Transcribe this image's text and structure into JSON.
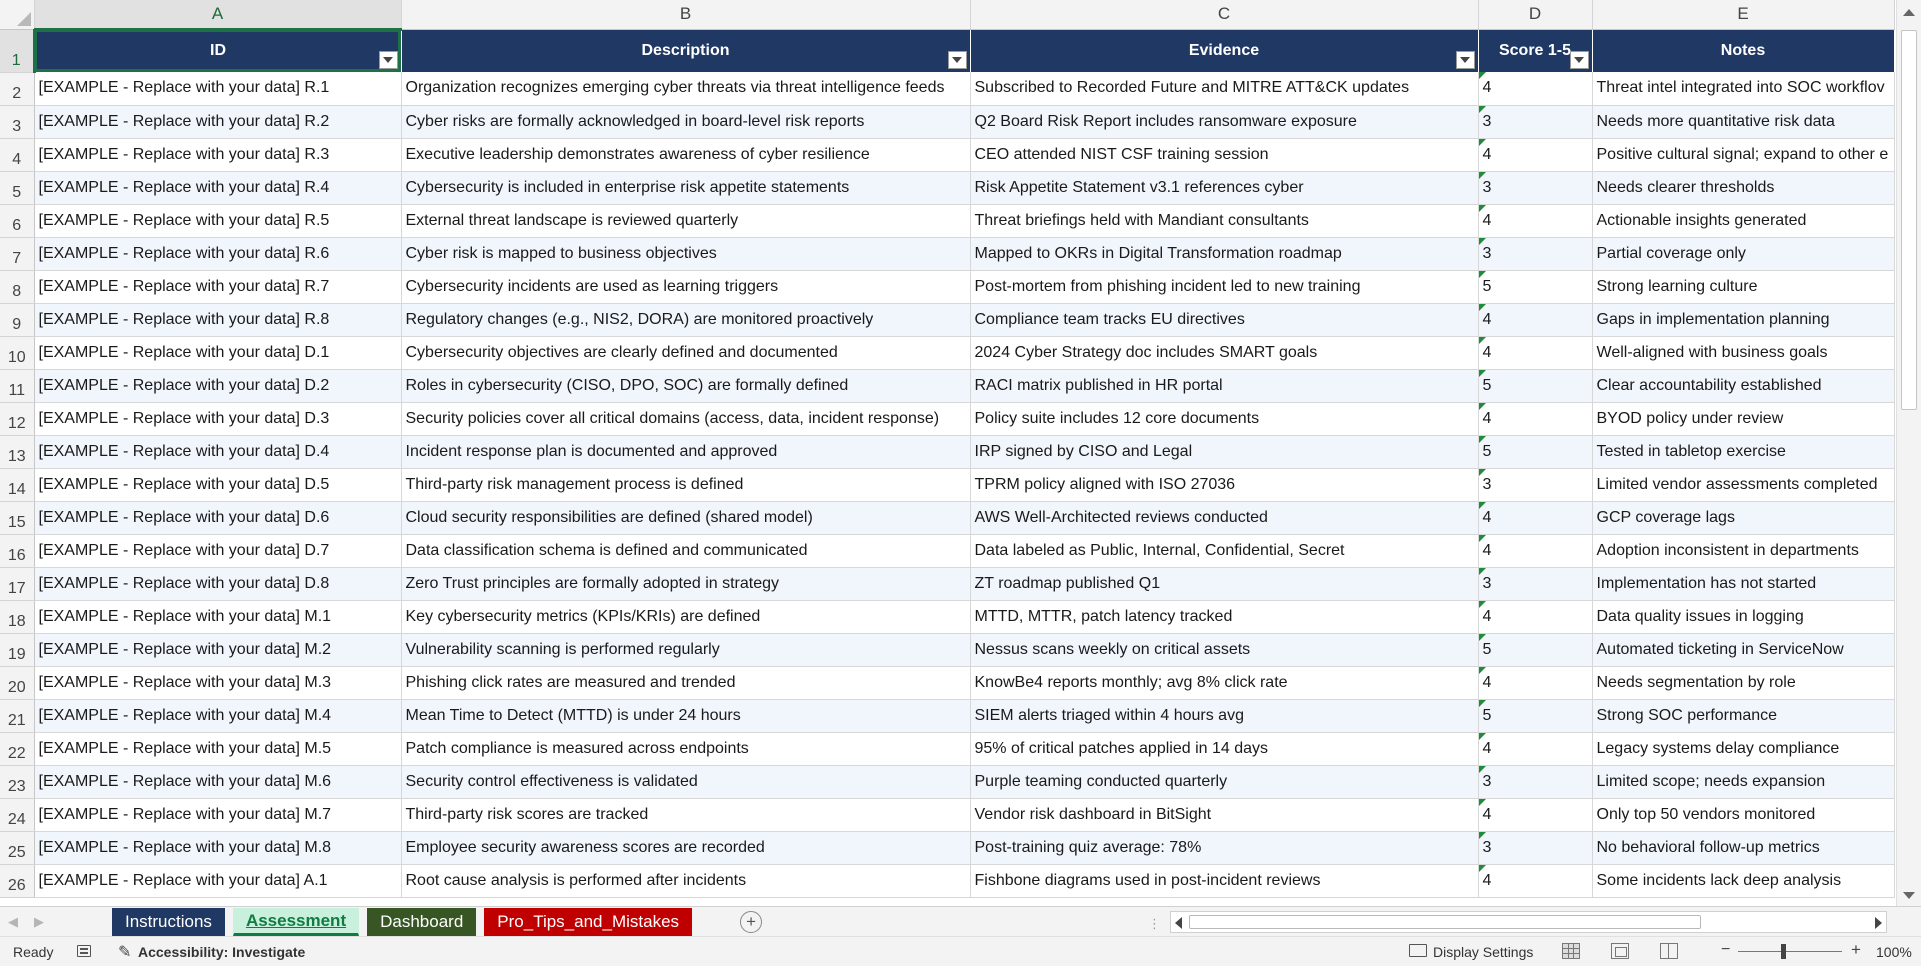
{
  "columns": {
    "a": "A",
    "b": "B",
    "c": "C",
    "d": "D",
    "e": "E"
  },
  "header": {
    "row_number": "1",
    "id": "ID",
    "description": "Description",
    "evidence": "Evidence",
    "score": "Score 1-5",
    "notes": "Notes"
  },
  "rows": [
    {
      "n": "2",
      "id": "[EXAMPLE - Replace with your data] R.1",
      "desc": "Organization recognizes emerging cyber threats via threat intelligence feeds",
      "evidence": "Subscribed to Recorded Future and MITRE ATT&CK updates",
      "score": "4",
      "notes": "Threat intel integrated into SOC workflov"
    },
    {
      "n": "3",
      "id": "[EXAMPLE - Replace with your data] R.2",
      "desc": "Cyber risks are formally acknowledged in board-level risk reports",
      "evidence": "Q2 Board Risk Report includes ransomware exposure",
      "score": "3",
      "notes": "Needs more quantitative risk data"
    },
    {
      "n": "4",
      "id": "[EXAMPLE - Replace with your data] R.3",
      "desc": "Executive leadership demonstrates awareness of cyber resilience",
      "evidence": "CEO attended NIST CSF training session",
      "score": "4",
      "notes": "Positive cultural signal; expand to other e"
    },
    {
      "n": "5",
      "id": "[EXAMPLE - Replace with your data] R.4",
      "desc": "Cybersecurity is included in enterprise risk appetite statements",
      "evidence": "Risk Appetite Statement v3.1 references cyber",
      "score": "3",
      "notes": "Needs clearer thresholds"
    },
    {
      "n": "6",
      "id": "[EXAMPLE - Replace with your data] R.5",
      "desc": "External threat landscape is reviewed quarterly",
      "evidence": "Threat briefings held with Mandiant consultants",
      "score": "4",
      "notes": "Actionable insights generated"
    },
    {
      "n": "7",
      "id": "[EXAMPLE - Replace with your data] R.6",
      "desc": "Cyber risk is mapped to business objectives",
      "evidence": "Mapped to OKRs in Digital Transformation roadmap",
      "score": "3",
      "notes": "Partial coverage only"
    },
    {
      "n": "8",
      "id": "[EXAMPLE - Replace with your data] R.7",
      "desc": "Cybersecurity incidents are used as learning triggers",
      "evidence": "Post-mortem from phishing incident led to new training",
      "score": "5",
      "notes": "Strong learning culture"
    },
    {
      "n": "9",
      "id": "[EXAMPLE - Replace with your data] R.8",
      "desc": "Regulatory changes (e.g., NIS2, DORA) are monitored proactively",
      "evidence": "Compliance team tracks EU directives",
      "score": "4",
      "notes": "Gaps in implementation planning"
    },
    {
      "n": "10",
      "id": "[EXAMPLE - Replace with your data] D.1",
      "desc": "Cybersecurity objectives are clearly defined and documented",
      "evidence": "2024 Cyber Strategy doc includes SMART goals",
      "score": "4",
      "notes": "Well-aligned with business goals"
    },
    {
      "n": "11",
      "id": "[EXAMPLE - Replace with your data] D.2",
      "desc": "Roles in cybersecurity (CISO, DPO, SOC) are formally defined",
      "evidence": "RACI matrix published in HR portal",
      "score": "5",
      "notes": "Clear accountability established"
    },
    {
      "n": "12",
      "id": "[EXAMPLE - Replace with your data] D.3",
      "desc": "Security policies cover all critical domains (access, data, incident response)",
      "evidence": "Policy suite includes 12 core documents",
      "score": "4",
      "notes": "BYOD policy under review"
    },
    {
      "n": "13",
      "id": "[EXAMPLE - Replace with your data] D.4",
      "desc": "Incident response plan is documented and approved",
      "evidence": "IRP signed by CISO and Legal",
      "score": "5",
      "notes": "Tested in tabletop exercise"
    },
    {
      "n": "14",
      "id": "[EXAMPLE - Replace with your data] D.5",
      "desc": "Third-party risk management process is defined",
      "evidence": "TPRM policy aligned with ISO 27036",
      "score": "3",
      "notes": "Limited vendor assessments completed"
    },
    {
      "n": "15",
      "id": "[EXAMPLE - Replace with your data] D.6",
      "desc": "Cloud security responsibilities are defined (shared model)",
      "evidence": "AWS Well-Architected reviews conducted",
      "score": "4",
      "notes": "GCP coverage lags"
    },
    {
      "n": "16",
      "id": "[EXAMPLE - Replace with your data] D.7",
      "desc": "Data classification schema is defined and communicated",
      "evidence": "Data labeled as Public, Internal, Confidential, Secret",
      "score": "4",
      "notes": "Adoption inconsistent in departments"
    },
    {
      "n": "17",
      "id": "[EXAMPLE - Replace with your data] D.8",
      "desc": "Zero Trust principles are formally adopted in strategy",
      "evidence": "ZT roadmap published Q1",
      "score": "3",
      "notes": "Implementation has not started"
    },
    {
      "n": "18",
      "id": "[EXAMPLE - Replace with your data] M.1",
      "desc": "Key cybersecurity metrics (KPIs/KRIs) are defined",
      "evidence": "MTTD, MTTR, patch latency tracked",
      "score": "4",
      "notes": "Data quality issues in logging"
    },
    {
      "n": "19",
      "id": "[EXAMPLE - Replace with your data] M.2",
      "desc": "Vulnerability scanning is performed regularly",
      "evidence": "Nessus scans weekly on critical assets",
      "score": "5",
      "notes": "Automated ticketing in ServiceNow"
    },
    {
      "n": "20",
      "id": "[EXAMPLE - Replace with your data] M.3",
      "desc": "Phishing click rates are measured and trended",
      "evidence": "KnowBe4 reports monthly; avg 8% click rate",
      "score": "4",
      "notes": "Needs segmentation by role"
    },
    {
      "n": "21",
      "id": "[EXAMPLE - Replace with your data] M.4",
      "desc": "Mean Time to Detect (MTTD) is under 24 hours",
      "evidence": "SIEM alerts triaged within 4 hours avg",
      "score": "5",
      "notes": "Strong SOC performance"
    },
    {
      "n": "22",
      "id": "[EXAMPLE - Replace with your data] M.5",
      "desc": "Patch compliance is measured across endpoints",
      "evidence": "95% of critical patches applied in 14 days",
      "score": "4",
      "notes": "Legacy systems delay compliance"
    },
    {
      "n": "23",
      "id": "[EXAMPLE - Replace with your data] M.6",
      "desc": "Security control effectiveness is validated",
      "evidence": "Purple teaming conducted quarterly",
      "score": "3",
      "notes": "Limited scope; needs expansion"
    },
    {
      "n": "24",
      "id": "[EXAMPLE - Replace with your data] M.7",
      "desc": "Third-party risk scores are tracked",
      "evidence": "Vendor risk dashboard in BitSight",
      "score": "4",
      "notes": "Only top 50 vendors monitored"
    },
    {
      "n": "25",
      "id": "[EXAMPLE - Replace with your data] M.8",
      "desc": "Employee security awareness scores are recorded",
      "evidence": "Post-training quiz average: 78%",
      "score": "3",
      "notes": "No behavioral follow-up metrics"
    },
    {
      "n": "26",
      "id": "[EXAMPLE - Replace with your data] A.1",
      "desc": "Root cause analysis is performed after incidents",
      "evidence": "Fishbone diagrams used in post-incident reviews",
      "score": "4",
      "notes": "Some incidents lack deep analysis"
    }
  ],
  "tabs": [
    {
      "label": "Instructions",
      "color": "#1f3864"
    },
    {
      "label": "Assessment",
      "color": "#c8f0dc"
    },
    {
      "label": "Dashboard",
      "color": "#375623"
    },
    {
      "label": "Pro_Tips_and_Mistakes",
      "color": "#c00000"
    }
  ],
  "status": {
    "ready": "Ready",
    "accessibility": "Accessibility: Investigate",
    "display_settings": "Display Settings",
    "zoom": "100%"
  },
  "icons": {
    "add_sheet": "+",
    "zoom_out": "−",
    "zoom_in": "+"
  },
  "colors": {
    "header_fill": "#1f3864",
    "alt_row_fill": "#f1f5fc",
    "accent_green": "#107c41"
  }
}
